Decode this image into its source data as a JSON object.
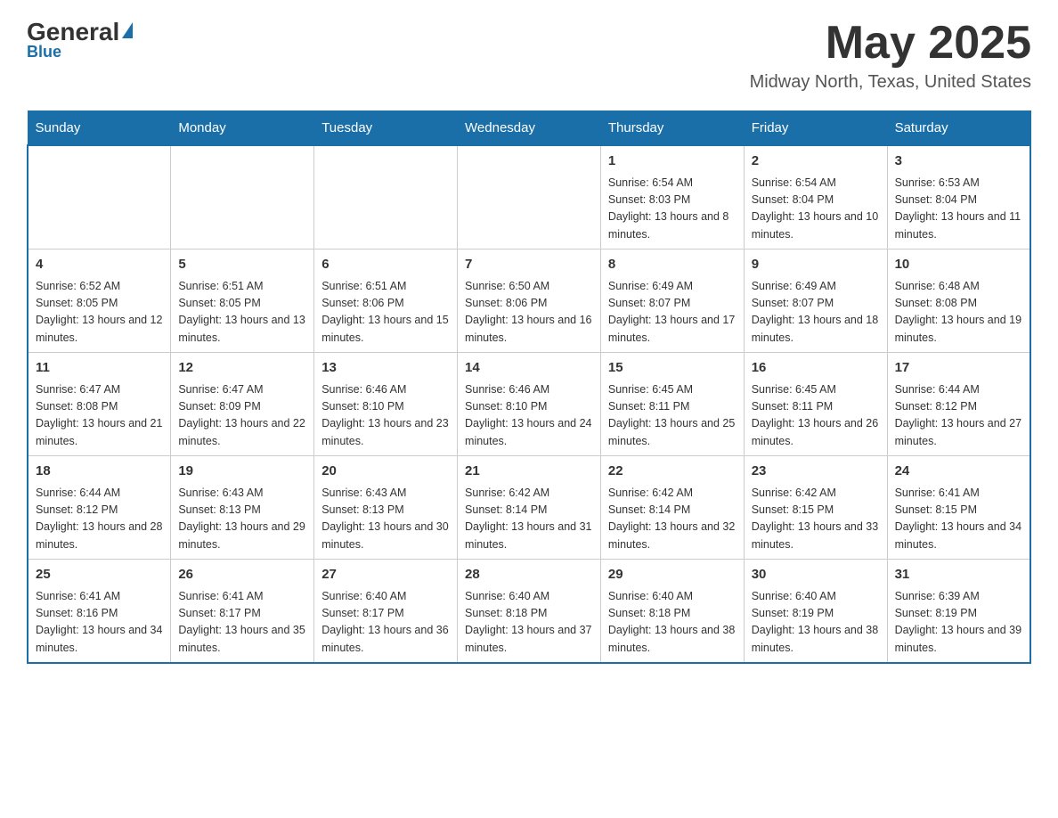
{
  "logo": {
    "general": "General",
    "blue": "Blue"
  },
  "title": "May 2025",
  "location": "Midway North, Texas, United States",
  "days_of_week": [
    "Sunday",
    "Monday",
    "Tuesday",
    "Wednesday",
    "Thursday",
    "Friday",
    "Saturday"
  ],
  "weeks": [
    [
      {
        "day": "",
        "info": ""
      },
      {
        "day": "",
        "info": ""
      },
      {
        "day": "",
        "info": ""
      },
      {
        "day": "",
        "info": ""
      },
      {
        "day": "1",
        "info": "Sunrise: 6:54 AM\nSunset: 8:03 PM\nDaylight: 13 hours and 8 minutes."
      },
      {
        "day": "2",
        "info": "Sunrise: 6:54 AM\nSunset: 8:04 PM\nDaylight: 13 hours and 10 minutes."
      },
      {
        "day": "3",
        "info": "Sunrise: 6:53 AM\nSunset: 8:04 PM\nDaylight: 13 hours and 11 minutes."
      }
    ],
    [
      {
        "day": "4",
        "info": "Sunrise: 6:52 AM\nSunset: 8:05 PM\nDaylight: 13 hours and 12 minutes."
      },
      {
        "day": "5",
        "info": "Sunrise: 6:51 AM\nSunset: 8:05 PM\nDaylight: 13 hours and 13 minutes."
      },
      {
        "day": "6",
        "info": "Sunrise: 6:51 AM\nSunset: 8:06 PM\nDaylight: 13 hours and 15 minutes."
      },
      {
        "day": "7",
        "info": "Sunrise: 6:50 AM\nSunset: 8:06 PM\nDaylight: 13 hours and 16 minutes."
      },
      {
        "day": "8",
        "info": "Sunrise: 6:49 AM\nSunset: 8:07 PM\nDaylight: 13 hours and 17 minutes."
      },
      {
        "day": "9",
        "info": "Sunrise: 6:49 AM\nSunset: 8:07 PM\nDaylight: 13 hours and 18 minutes."
      },
      {
        "day": "10",
        "info": "Sunrise: 6:48 AM\nSunset: 8:08 PM\nDaylight: 13 hours and 19 minutes."
      }
    ],
    [
      {
        "day": "11",
        "info": "Sunrise: 6:47 AM\nSunset: 8:08 PM\nDaylight: 13 hours and 21 minutes."
      },
      {
        "day": "12",
        "info": "Sunrise: 6:47 AM\nSunset: 8:09 PM\nDaylight: 13 hours and 22 minutes."
      },
      {
        "day": "13",
        "info": "Sunrise: 6:46 AM\nSunset: 8:10 PM\nDaylight: 13 hours and 23 minutes."
      },
      {
        "day": "14",
        "info": "Sunrise: 6:46 AM\nSunset: 8:10 PM\nDaylight: 13 hours and 24 minutes."
      },
      {
        "day": "15",
        "info": "Sunrise: 6:45 AM\nSunset: 8:11 PM\nDaylight: 13 hours and 25 minutes."
      },
      {
        "day": "16",
        "info": "Sunrise: 6:45 AM\nSunset: 8:11 PM\nDaylight: 13 hours and 26 minutes."
      },
      {
        "day": "17",
        "info": "Sunrise: 6:44 AM\nSunset: 8:12 PM\nDaylight: 13 hours and 27 minutes."
      }
    ],
    [
      {
        "day": "18",
        "info": "Sunrise: 6:44 AM\nSunset: 8:12 PM\nDaylight: 13 hours and 28 minutes."
      },
      {
        "day": "19",
        "info": "Sunrise: 6:43 AM\nSunset: 8:13 PM\nDaylight: 13 hours and 29 minutes."
      },
      {
        "day": "20",
        "info": "Sunrise: 6:43 AM\nSunset: 8:13 PM\nDaylight: 13 hours and 30 minutes."
      },
      {
        "day": "21",
        "info": "Sunrise: 6:42 AM\nSunset: 8:14 PM\nDaylight: 13 hours and 31 minutes."
      },
      {
        "day": "22",
        "info": "Sunrise: 6:42 AM\nSunset: 8:14 PM\nDaylight: 13 hours and 32 minutes."
      },
      {
        "day": "23",
        "info": "Sunrise: 6:42 AM\nSunset: 8:15 PM\nDaylight: 13 hours and 33 minutes."
      },
      {
        "day": "24",
        "info": "Sunrise: 6:41 AM\nSunset: 8:15 PM\nDaylight: 13 hours and 34 minutes."
      }
    ],
    [
      {
        "day": "25",
        "info": "Sunrise: 6:41 AM\nSunset: 8:16 PM\nDaylight: 13 hours and 34 minutes."
      },
      {
        "day": "26",
        "info": "Sunrise: 6:41 AM\nSunset: 8:17 PM\nDaylight: 13 hours and 35 minutes."
      },
      {
        "day": "27",
        "info": "Sunrise: 6:40 AM\nSunset: 8:17 PM\nDaylight: 13 hours and 36 minutes."
      },
      {
        "day": "28",
        "info": "Sunrise: 6:40 AM\nSunset: 8:18 PM\nDaylight: 13 hours and 37 minutes."
      },
      {
        "day": "29",
        "info": "Sunrise: 6:40 AM\nSunset: 8:18 PM\nDaylight: 13 hours and 38 minutes."
      },
      {
        "day": "30",
        "info": "Sunrise: 6:40 AM\nSunset: 8:19 PM\nDaylight: 13 hours and 38 minutes."
      },
      {
        "day": "31",
        "info": "Sunrise: 6:39 AM\nSunset: 8:19 PM\nDaylight: 13 hours and 39 minutes."
      }
    ]
  ]
}
